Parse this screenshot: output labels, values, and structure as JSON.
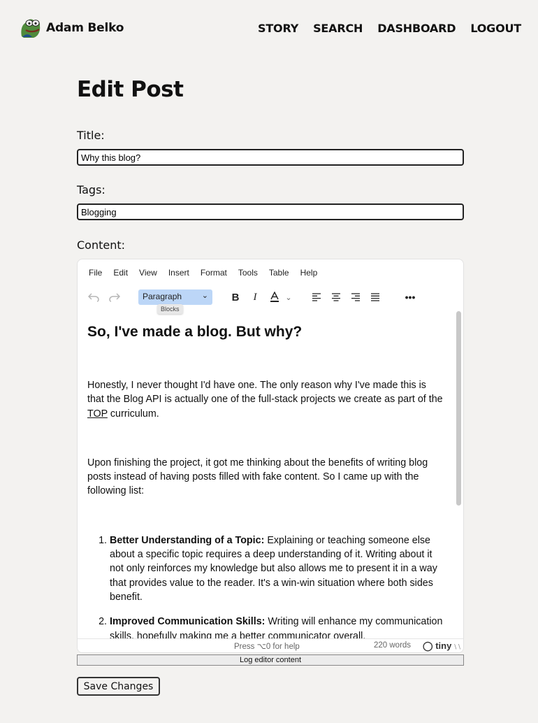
{
  "header": {
    "brand_name": "Adam Belko",
    "nav": [
      "STORY",
      "SEARCH",
      "DASHBOARD",
      "LOGOUT"
    ]
  },
  "page_title": "Edit Post",
  "form": {
    "title_label": "Title:",
    "title_value": "Why this blog?",
    "tags_label": "Tags:",
    "tags_value": "Blogging",
    "content_label": "Content:"
  },
  "editor": {
    "menu": [
      "File",
      "Edit",
      "View",
      "Insert",
      "Format",
      "Tools",
      "Table",
      "Help"
    ],
    "block_select": "Paragraph",
    "tooltip": "Blocks",
    "heading": "So, I've made a blog. But why?",
    "p1_before": "Honestly, I never thought I'd have one. The only reason why I've made this is that the Blog API is actually one of the full-stack projects we create as part of the ",
    "p1_link": "TOP",
    "p1_after": " curriculum.",
    "p2": "Upon finishing the project, it got me thinking about the benefits of writing blog posts instead of having posts filled with fake content. So I came up with the following list:",
    "list": [
      {
        "bold": "Better Understanding of a Topic:",
        "text": " Explaining or teaching someone else about a specific topic requires a deep understanding of it. Writing about it not only reinforces my knowledge but also allows me to present it in a way that provides value to the reader. It's a win-win situation where both sides benefit."
      },
      {
        "bold": "Improved Communication Skills:",
        "text": " Writing will enhance my communication skills, hopefully making me a better communicator overall."
      }
    ],
    "status_help": "Press ⌥0 for help",
    "word_count": "220 words",
    "tiny_brand": "tiny"
  },
  "log_button": "Log editor content",
  "save_button": "Save Changes"
}
